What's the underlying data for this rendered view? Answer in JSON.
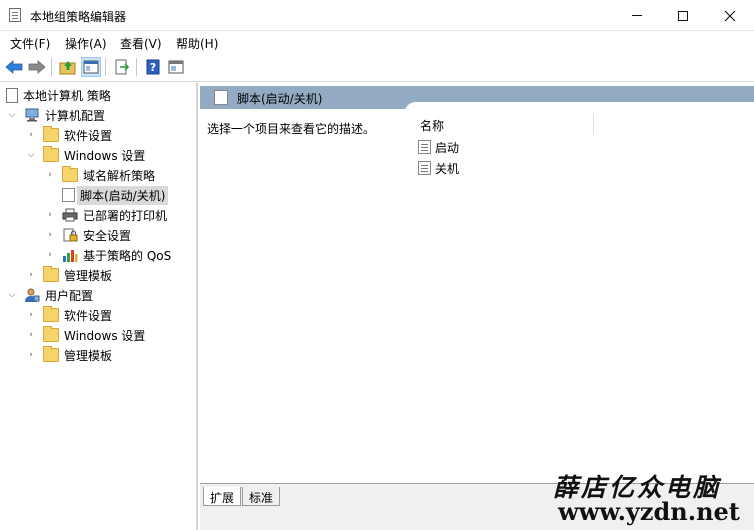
{
  "window": {
    "title": "本地组策略编辑器",
    "minimize_label": "—",
    "maximize_label": "□",
    "close_label": "✕"
  },
  "menu": [
    {
      "label": "文件(F)"
    },
    {
      "label": "操作(A)"
    },
    {
      "label": "查看(V)"
    },
    {
      "label": "帮助(H)"
    }
  ],
  "toolbar": {
    "icons": [
      "back-arrow-icon",
      "forward-arrow-icon",
      "up-folder-icon",
      "show-hide-tree-icon",
      "export-list-icon",
      "help-icon",
      "properties-icon"
    ]
  },
  "tree": {
    "root": "本地计算机 策略",
    "computer_config": "计算机配置",
    "software_settings_1": "软件设置",
    "windows_settings_1": "Windows 设置",
    "name_resolution_policy": "域名解析策略",
    "scripts": "脚本(启动/关机)",
    "deployed_printers": "已部署的打印机",
    "security_settings": "安全设置",
    "qos": "基于策略的 QoS",
    "admin_templates_1": "管理模板",
    "user_config": "用户配置",
    "software_settings_2": "软件设置",
    "windows_settings_2": "Windows 设置",
    "admin_templates_2": "管理模板"
  },
  "right_pane": {
    "header_title": "脚本(启动/关机)",
    "description": "选择一个项目来查看它的描述。",
    "column_name": "名称",
    "items": [
      {
        "label": "启动"
      },
      {
        "label": "关机"
      }
    ]
  },
  "tabs": [
    {
      "label": "扩展"
    },
    {
      "label": "标准"
    }
  ],
  "watermark": {
    "line1": "薛店亿众电脑",
    "line2": "www.yzdn.net"
  },
  "colors": {
    "header_band": "#93aac3",
    "selected_row": "#d9d9d9",
    "folder": "#f6d36b"
  }
}
